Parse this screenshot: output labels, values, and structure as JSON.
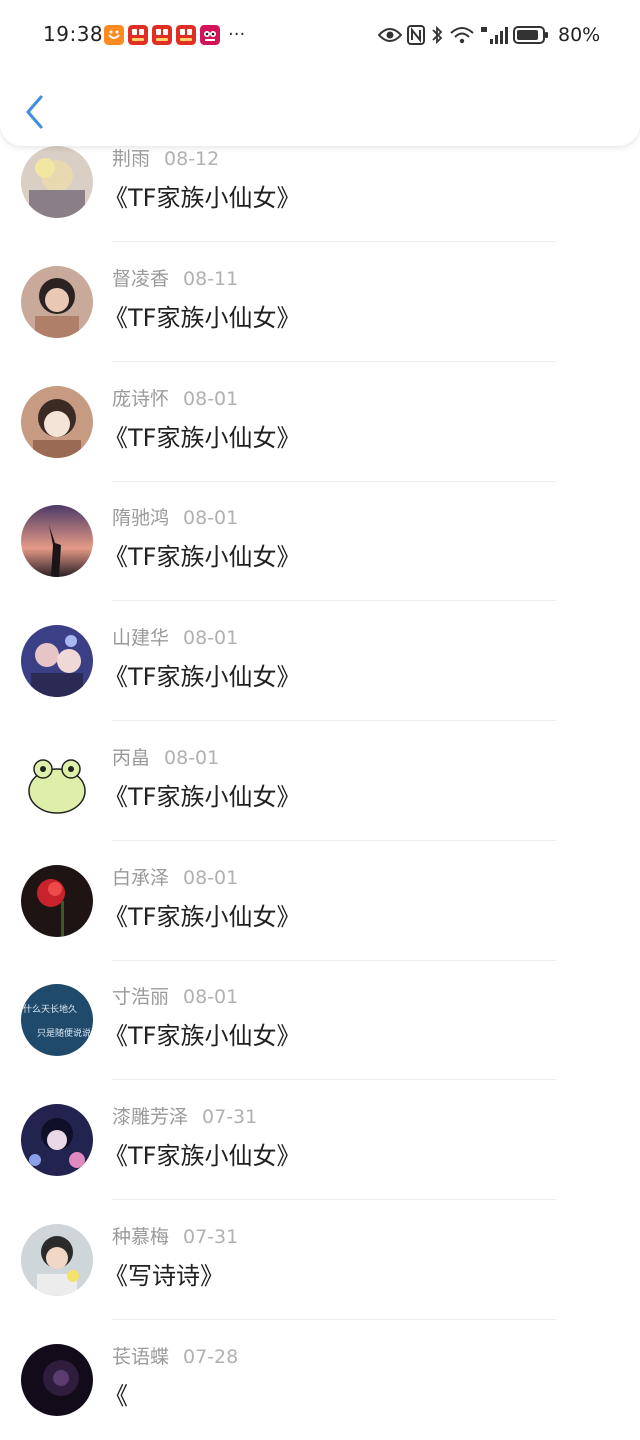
{
  "status_bar": {
    "time": "19:38",
    "battery_percent": "80%",
    "more_indicator": "···",
    "notification_icons": [
      "taobao-icon",
      "pinduoduo-icon",
      "pinduoduo-icon",
      "pinduoduo-icon",
      "tmall-icon"
    ],
    "system_icons": [
      "eye-icon",
      "nfc-icon",
      "bluetooth-icon",
      "wifi-icon",
      "signal-icon",
      "battery-icon"
    ]
  },
  "header": {
    "back_icon": "chevron-left-icon",
    "accent": "#3a8ee6"
  },
  "items": [
    {
      "name": "荆雨",
      "date": "08-12",
      "title": "《TF家族小仙女》"
    },
    {
      "name": "督凌香",
      "date": "08-11",
      "title": "《TF家族小仙女》"
    },
    {
      "name": "庞诗怀",
      "date": "08-01",
      "title": "《TF家族小仙女》"
    },
    {
      "name": "隋驰鸿",
      "date": "08-01",
      "title": "《TF家族小仙女》"
    },
    {
      "name": "山建华",
      "date": "08-01",
      "title": "《TF家族小仙女》"
    },
    {
      "name": "丙畠",
      "date": "08-01",
      "title": "《TF家族小仙女》"
    },
    {
      "name": "白承泽",
      "date": "08-01",
      "title": "《TF家族小仙女》"
    },
    {
      "name": "寸浩丽",
      "date": "08-01",
      "title": "《TF家族小仙女》",
      "avatar_text": [
        "什么天长地久",
        "只是随便说说"
      ]
    },
    {
      "name": "漆雕芳泽",
      "date": "07-31",
      "title": "《TF家族小仙女》"
    },
    {
      "name": "种慕梅",
      "date": "07-31",
      "title": "《写诗诗》"
    },
    {
      "name": "苌语蝶",
      "date": "07-28",
      "title": "《"
    }
  ]
}
